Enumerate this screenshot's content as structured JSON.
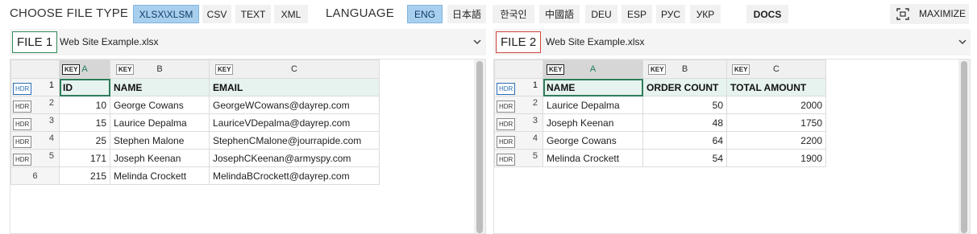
{
  "toolbar": {
    "file_type_label": "CHOOSE FILE TYPE",
    "file_types": [
      "XLSX\\XLSM",
      "CSV",
      "TEXT",
      "XML"
    ],
    "language_label": "LANGUAGE",
    "languages": [
      "ENG",
      "日本語",
      "한국인",
      "中國語",
      "DEU",
      "ESP",
      "РУС",
      "УКР"
    ],
    "docs_label": "DOCS",
    "maximize_label": "MAXIMIZE"
  },
  "file1": {
    "badge": "FILE 1",
    "badge_color": "#2e8b57",
    "name": "Web Site Example.xlsx",
    "key_label": "KEY",
    "hdr_label": "HDR",
    "columns": [
      "A",
      "B",
      "C"
    ],
    "rows": [
      {
        "num": "1",
        "cells": [
          "ID",
          "NAME",
          "EMAIL"
        ]
      },
      {
        "num": "2",
        "cells": [
          "10",
          "George Cowans",
          "GeorgeWCowans@dayrep.com"
        ]
      },
      {
        "num": "3",
        "cells": [
          "15",
          "Laurice Depalma",
          "LauriceVDepalma@dayrep.com"
        ]
      },
      {
        "num": "4",
        "cells": [
          "25",
          "Stephen Malone",
          "StephenCMalone@jourrapide.com"
        ]
      },
      {
        "num": "5",
        "cells": [
          "171",
          "Joseph Keenan",
          "JosephCKeenan@armyspy.com"
        ]
      },
      {
        "num": "6",
        "cells": [
          "215",
          "Melinda Crockett",
          "MelindaBCrockett@dayrep.com"
        ]
      }
    ]
  },
  "file2": {
    "badge": "FILE 2",
    "badge_color": "#d0453f",
    "name": "Web Site Example.xlsx",
    "key_label": "KEY",
    "hdr_label": "HDR",
    "columns": [
      "A",
      "B",
      "C"
    ],
    "rows": [
      {
        "num": "1",
        "cells": [
          "NAME",
          "ORDER COUNT",
          "TOTAL AMOUNT"
        ]
      },
      {
        "num": "2",
        "cells": [
          "Laurice Depalma",
          "50",
          "2000"
        ]
      },
      {
        "num": "3",
        "cells": [
          "Joseph Keenan",
          "48",
          "1750"
        ]
      },
      {
        "num": "4",
        "cells": [
          "George Cowans",
          "64",
          "2200"
        ]
      },
      {
        "num": "5",
        "cells": [
          "Melinda Crockett",
          "54",
          "1900"
        ]
      }
    ]
  },
  "colors": {
    "accent_active": "#a9cfee",
    "header_row_bg": "#e6f3ef",
    "selection": "#2f7d5a"
  }
}
